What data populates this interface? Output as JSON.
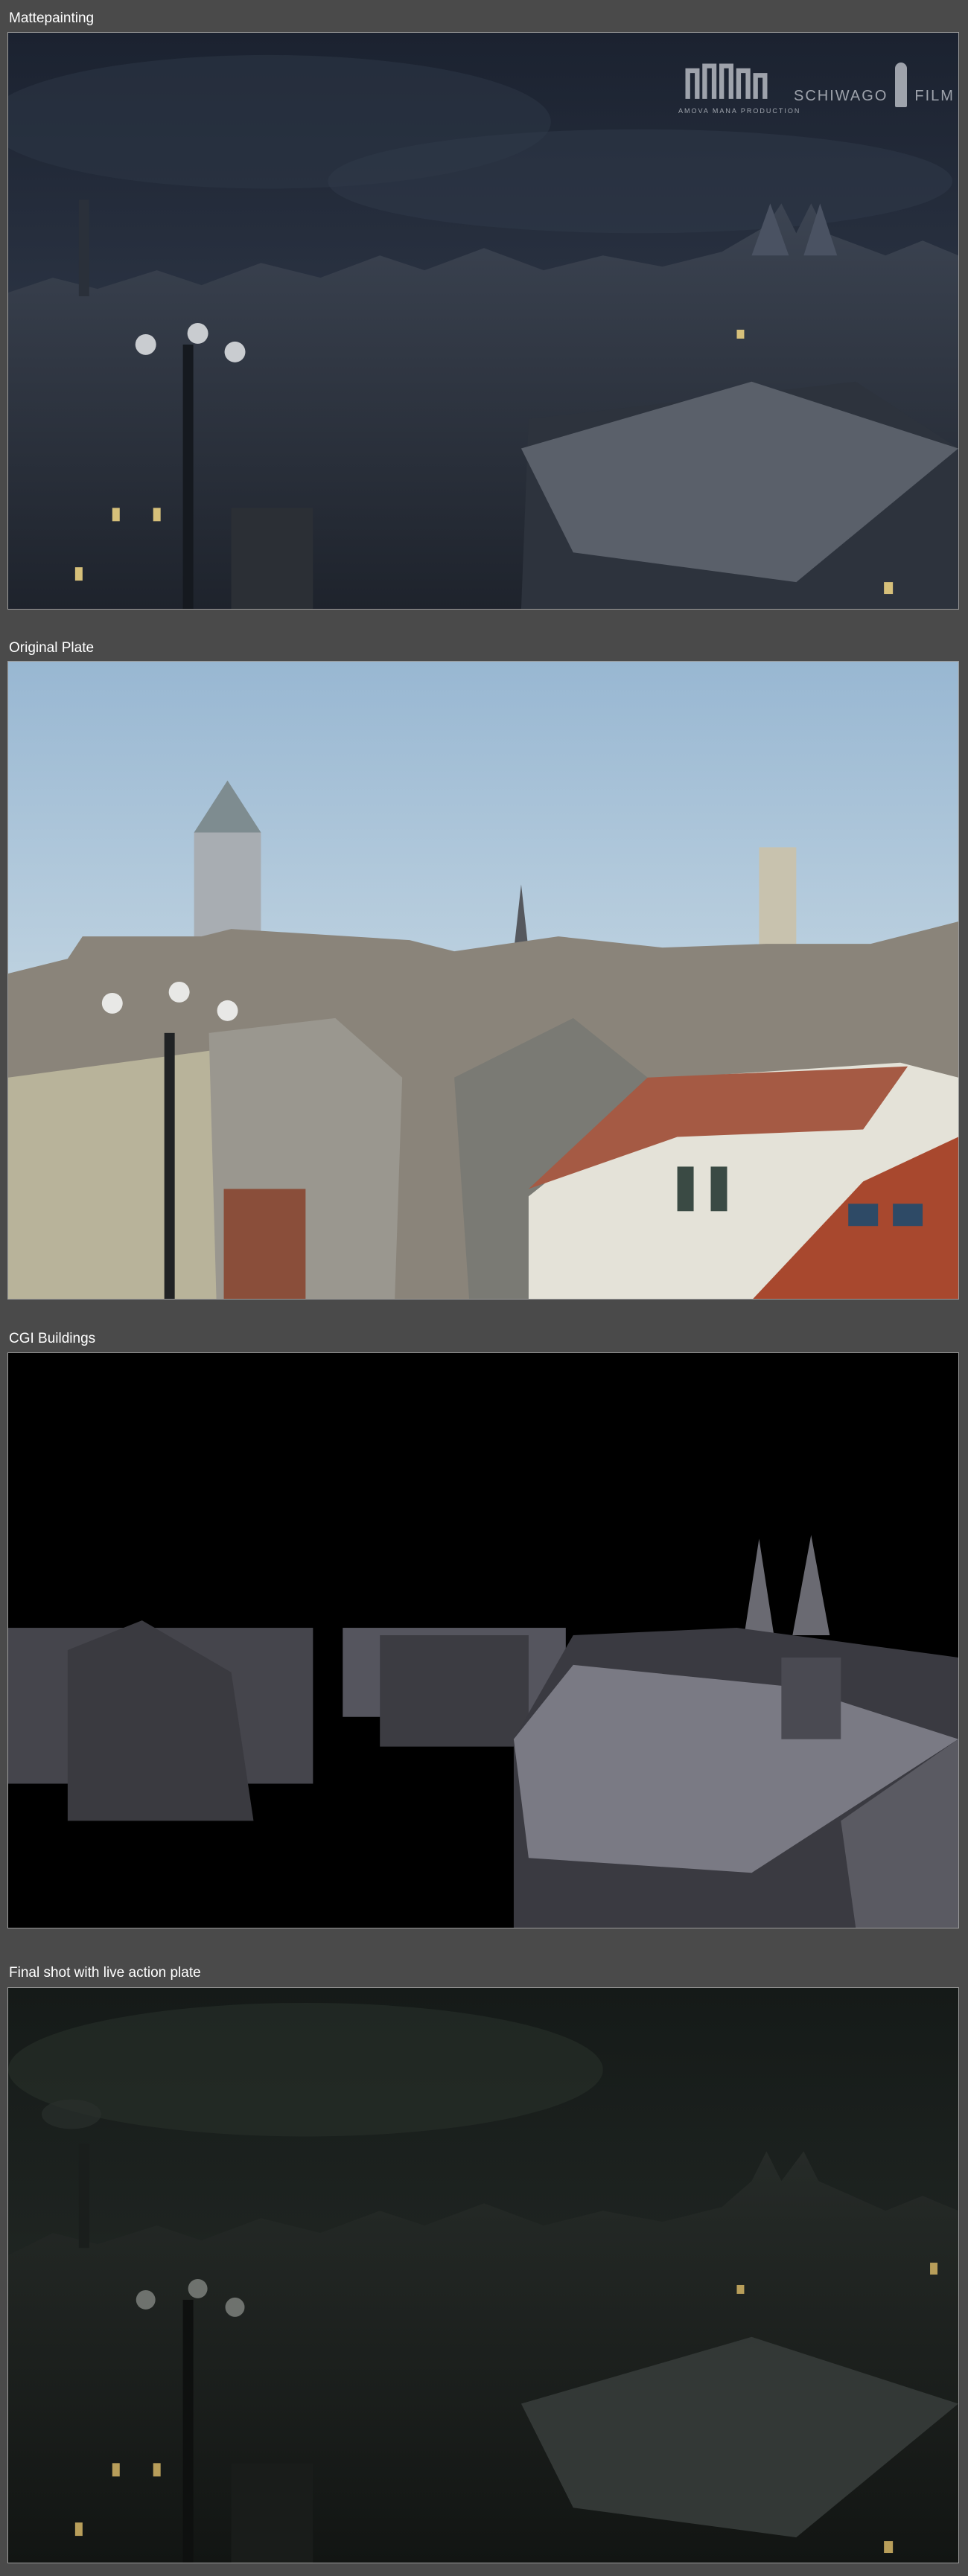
{
  "panels": [
    {
      "label": "Mattepainting",
      "variant": "matte"
    },
    {
      "label": "Original Plate",
      "variant": "plate"
    },
    {
      "label": "CGI Buildings",
      "variant": "cgi"
    },
    {
      "label": "Final shot with live action plate",
      "variant": "final"
    }
  ],
  "logos": {
    "amova": "AMOVA MANA PRODUCTION",
    "schiwago": "SCHIWAGO",
    "film": "FILM"
  },
  "colors": {
    "page_background": "#4a4a4a",
    "label_text": "#ffffff",
    "frame_border": "#9a9a9a"
  }
}
